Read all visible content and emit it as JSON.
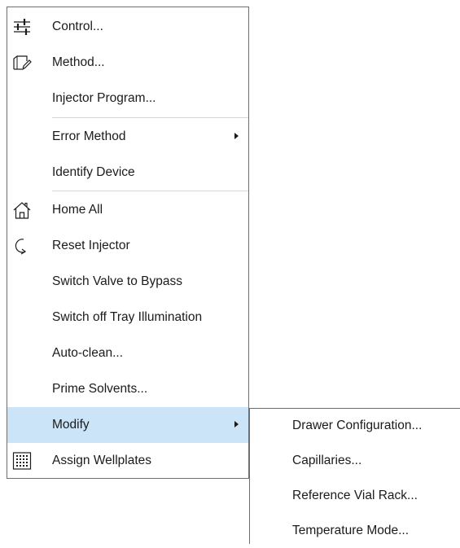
{
  "context_menu": {
    "items": [
      {
        "label": "Control...",
        "icon": "sliders-icon"
      },
      {
        "label": "Method...",
        "icon": "method-edit-icon"
      },
      {
        "label": "Injector Program...",
        "icon": ""
      },
      {
        "label": "Error Method",
        "icon": "",
        "has_submenu": true
      },
      {
        "label": "Identify Device",
        "icon": ""
      },
      {
        "label": "Home All",
        "icon": "home-icon"
      },
      {
        "label": "Reset Injector",
        "icon": "reset-arrow-icon"
      },
      {
        "label": "Switch Valve to Bypass",
        "icon": ""
      },
      {
        "label": "Switch off Tray Illumination",
        "icon": ""
      },
      {
        "label": "Auto-clean...",
        "icon": ""
      },
      {
        "label": "Prime Solvents...",
        "icon": ""
      },
      {
        "label": "Modify",
        "icon": "",
        "has_submenu": true,
        "highlighted": true
      },
      {
        "label": "Assign Wellplates",
        "icon": "wellplate-grid-icon"
      }
    ]
  },
  "modify_submenu": {
    "items": [
      {
        "label": "Drawer Configuration..."
      },
      {
        "label": "Capillaries..."
      },
      {
        "label": "Reference Vial Rack..."
      },
      {
        "label": "Temperature Mode..."
      }
    ]
  },
  "colors": {
    "highlight": "#cce4f7",
    "border": "#6e6e6e",
    "separator": "#d6d6d6",
    "text": "#1b1b1b"
  }
}
